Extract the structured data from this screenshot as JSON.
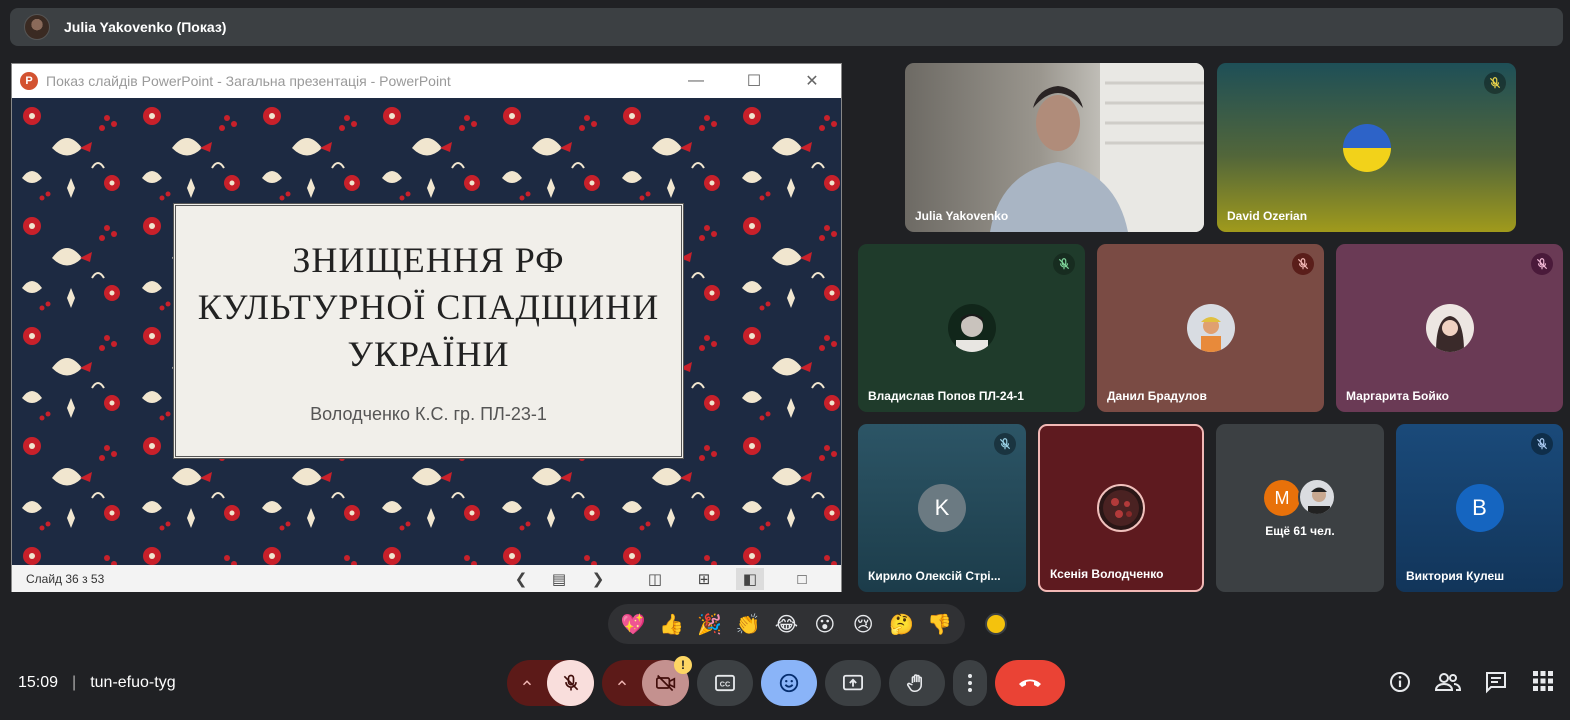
{
  "presenter_bar": {
    "title": "Julia Yakovenko (Показ)"
  },
  "ppt_window": {
    "title": "Показ слайдів PowerPoint  -  Загальна презентація - PowerPoint",
    "logo": "P",
    "slide": {
      "title_lines": [
        "ЗНИЩЕННЯ РФ",
        "КУЛЬТУРНОЇ СПАДЩИНИ",
        "УКРАЇНИ"
      ],
      "subtitle": "Володченко К.С. гр. ПЛ-23-1"
    },
    "status": {
      "counter": "Слайд 36 з 53"
    }
  },
  "participants": [
    {
      "name": "Julia Yakovenko",
      "muted": false,
      "kind": "video"
    },
    {
      "name": "David Ozerian",
      "muted": true,
      "kind": "flag"
    },
    {
      "name": "Владислав Попов ПЛ-24-1",
      "muted": true,
      "kind": "avatar"
    },
    {
      "name": "Данил Брадулов",
      "muted": true,
      "kind": "avatar"
    },
    {
      "name": "Маргарита Бойко",
      "muted": true,
      "kind": "avatar"
    },
    {
      "name": "Кирило Олексій Стрі...",
      "muted": true,
      "kind": "letter",
      "letter": "K"
    },
    {
      "name": "Ксенія Володченко",
      "muted": false,
      "kind": "avatar"
    },
    {
      "name": "Ещё 61 чел.",
      "kind": "more",
      "letter": "M"
    },
    {
      "name": "Виктория Кулеш",
      "muted": true,
      "kind": "letter",
      "letter": "B"
    }
  ],
  "reactions": [
    "💖",
    "👍",
    "🎉",
    "👏",
    "😂",
    "😮",
    "😢",
    "🤔",
    "👎"
  ],
  "meeting": {
    "time": "15:09",
    "separator": "|",
    "code": "tun-efuo-tyg"
  },
  "alert_badge": "!",
  "colors": {
    "accent_blue": "#8ab4f8",
    "end_call": "#ea4335",
    "mic_off_bg": "#f9dedc"
  }
}
